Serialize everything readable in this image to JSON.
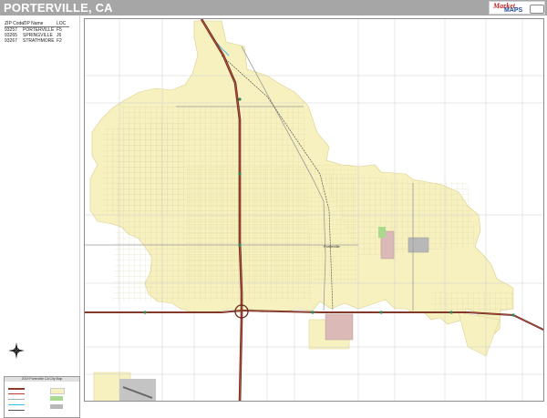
{
  "title": "PORTERVILLE, CA",
  "logo": {
    "brand_line1": "Market",
    "brand_line2": "MAPS"
  },
  "zip_table": {
    "headers": [
      "ZIP Code",
      "ZIP Name",
      "LOC"
    ],
    "rows": [
      [
        "93257",
        "PORTERVILLE",
        "F5"
      ],
      [
        "93265",
        "SPRINGVILLE",
        "J6"
      ],
      [
        "93267",
        "STRATHMORE",
        "F2"
      ]
    ]
  },
  "map": {
    "colors": {
      "city_fill": "#f7f1c0",
      "street": "#c9c9c9",
      "highway": "#8c3a2a",
      "interstate_edge": "#6b2a1f",
      "water": "#39b9e6",
      "industrial": "#b8b8b8",
      "park": "#a8d98c",
      "pink_zone": "#dbb9b6"
    },
    "place_labels": [
      "Porterville"
    ]
  },
  "legend": {
    "title": "2019 Porterville CA City Map"
  }
}
